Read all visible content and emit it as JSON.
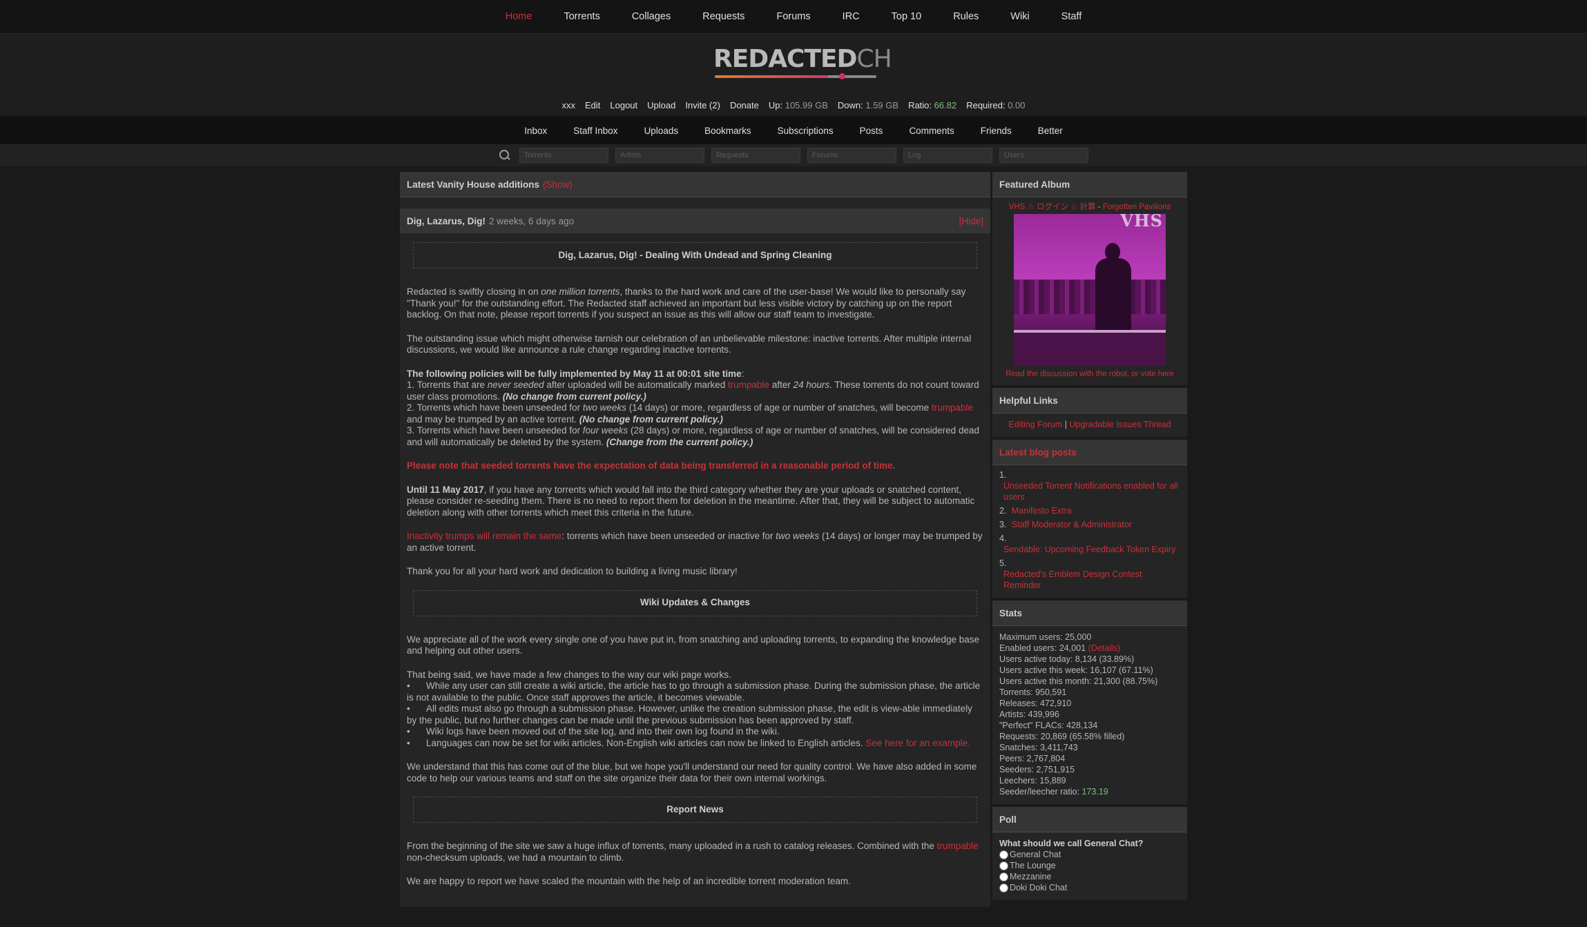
{
  "topnav": [
    "Home",
    "Torrents",
    "Collages",
    "Requests",
    "Forums",
    "IRC",
    "Top 10",
    "Rules",
    "Wiki",
    "Staff"
  ],
  "logo": {
    "main": "REDACTED",
    "suffix": "CH"
  },
  "userbar": {
    "username": "xxx",
    "edit": "Edit",
    "logout": "Logout",
    "upload": "Upload",
    "invite": "Invite (2)",
    "donate": "Donate",
    "up_label": "Up:",
    "up_value": "105.99 GB",
    "down_label": "Down:",
    "down_value": "1.59 GB",
    "ratio_label": "Ratio:",
    "ratio_value": "66.82",
    "required_label": "Required:",
    "required_value": "0.00"
  },
  "secnav": [
    "Inbox",
    "Staff Inbox",
    "Uploads",
    "Bookmarks",
    "Subscriptions",
    "Posts",
    "Comments",
    "Friends",
    "Better"
  ],
  "search": {
    "placeholders": [
      "Torrents",
      "Artists",
      "Requests",
      "Forums",
      "Log",
      "Users"
    ]
  },
  "main": {
    "vanity_title": "Latest Vanity House additions",
    "vanity_toggle": "(Show)",
    "news_title": "Dig, Lazarus, Dig!",
    "news_date": "2 weeks, 6 days ago",
    "news_hide": "[Hide]",
    "section1_title": "Dig, Lazarus, Dig! - Dealing With Undead and Spring Cleaning",
    "p1a": "Redacted is swiftly closing in on ",
    "p1b": "one million torrents",
    "p1c": ", thanks to the hard work and care of the user-base! We would like to personally say \"Thank you!\" for the outstanding effort. The Redacted staff achieved an important but less visible victory by catching up on the report backlog. On that note, please report torrents if you suspect an issue as this will allow our staff team to investigate.",
    "p2": "The outstanding issue which might otherwise tarnish our celebration of an unbelievable milestone: inactive torrents. After multiple internal discussions, we would like announce a rule change regarding inactive torrents.",
    "policy_head": "The following policies will be fully implemented by May 11 at 00:01 site time",
    "policy_colon": ":",
    "pol1a": "1. Torrents that are ",
    "pol1b": "never seeded",
    "pol1c": " after uploaded will be automatically marked ",
    "pol1d": "trumpable",
    "pol1e": " after ",
    "pol1f": "24 hours",
    "pol1g": ". These torrents do not count toward user class promotions. ",
    "pol1h": "(No change from current policy.)",
    "pol2a": "2. Torrents which have been unseeded for ",
    "pol2b": "two weeks",
    "pol2c": " (14 days) or more, regardless of age or number of snatches, will become ",
    "pol2d": "trumpable",
    "pol2e": " and may be trumped by an active torrent. ",
    "pol2f": "(No change from current policy.)",
    "pol3a": "3. Torrents which have been unseeded for ",
    "pol3b": "four weeks",
    "pol3c": " (28 days) or more, regardless of age or number of snatches, will be considered dead and will automatically be deleted by the system. ",
    "pol3d": "(Change from the current policy.)",
    "note": "Please note that seeded torrents have the expectation of data being transferred in a reasonable period of time.",
    "until_b": "Until 11 May 2017",
    "until_rest": ", if you have any torrents which would fall into the third category whether they are your uploads or snatched content, please consider re-seeding them. There is no need to report them for deletion in the meantime. After that, they will be subject to automatic deletion along with other torrents which meet this criteria in the future.",
    "inact_link": "Inactivity trumps will remain the same",
    "inact_a": ": torrents which have been unseeded or inactive for ",
    "inact_b": "two weeks",
    "inact_c": " (14 days) or longer may be trumped by an active torrent.",
    "thanks": "Thank you for all your hard work and dedication to building a living music library!",
    "section2_title": "Wiki Updates & Changes",
    "w1": "We appreciate all of the work every single one of you have put in, from snatching and uploading torrents, to expanding the knowledge base and helping out other users.",
    "w2": "That being said, we have made a few changes to the way our wiki page works.",
    "bullet": "•",
    "wl1": "While any user can still create a wiki article, the article has to go through a submission phase. During the submission phase, the article is not available to the public. Once staff approves the article, it becomes viewable.",
    "wl2": "All edits must also go through a submission phase. However, unlike the creation submission phase, the edit is view-able immediately by the public, but no further changes can be made until the previous submission has been approved by staff.",
    "wl3": "Wiki logs have been moved out of the site log, and into their own log found in the wiki.",
    "wl4": "Languages can now be set for wiki articles. Non-English wiki articles can now be linked to English articles. ",
    "wl4_link": "See here for an example.",
    "w3": "We understand that this has come out of the blue, but we hope you'll understand our need for quality control. We have also added in some code to help our various teams and staff on the site organize their data for their own internal workings.",
    "section3_title": "Report News",
    "r1a": "From the beginning of the site we saw a huge influx of torrents, many uploaded in a rush to catalog releases. Combined with the ",
    "r1b": "trumpable",
    "r1c": " non-checksum uploads, we had a mountain to climb.",
    "r2": "We are happy to report we have scaled the mountain with the help of an incredible torrent moderation team."
  },
  "side": {
    "featured_title": "Featured Album",
    "album_artist": "VHS ☆ ログイン ☆ 計算",
    "album_sep": " - ",
    "album_name": "Forgotten Pavilions",
    "cover_text": "VHS",
    "album_discuss": "Read the discussion with the robot, or vote here",
    "helpful_title": "Helpful Links",
    "helpful_1": "Editing Forum",
    "helpful_sep": "|",
    "helpful_2": "Upgradable Issues Thread",
    "blog_title": "Latest blog posts",
    "blog": [
      {
        "n": "1.",
        "t": "Unseeded Torrent Notifications enabled for all users"
      },
      {
        "n": "2.",
        "t": "Manifesto Extra"
      },
      {
        "n": "3.",
        "t": "Staff Moderator & Administrator"
      },
      {
        "n": "4.",
        "t": "Sendable: Upcoming Feedback Token Expiry"
      },
      {
        "n": "5.",
        "t": "Redacted's Emblem Design Contest Reminder"
      }
    ],
    "stats_title": "Stats",
    "stats": [
      "Maximum users: 25,000",
      "Enabled users: 24,001",
      "Users active today: 8,134 (33.89%)",
      "Users active this week: 16,107 (67.11%)",
      "Users active this month: 21,300 (88.75%)",
      "Torrents: 950,591",
      "Releases: 472,910",
      "Artists: 439,996",
      "\"Perfect\" FLACs: 428,134",
      "Requests: 20,869 (65.58% filled)",
      "Snatches: 3,411,743",
      "Peers: 2,767,804",
      "Seeders: 2,751,915",
      "Leechers: 15,889"
    ],
    "stats_details": "(Details)",
    "ratio_label": "Seeder/leecher ratio: ",
    "ratio_value": "173.19",
    "poll_title": "Poll",
    "poll_q": "What should we call General Chat?",
    "poll_options": [
      "General Chat",
      "The Lounge",
      "Mezzanine",
      "Doki Doki Chat"
    ]
  }
}
